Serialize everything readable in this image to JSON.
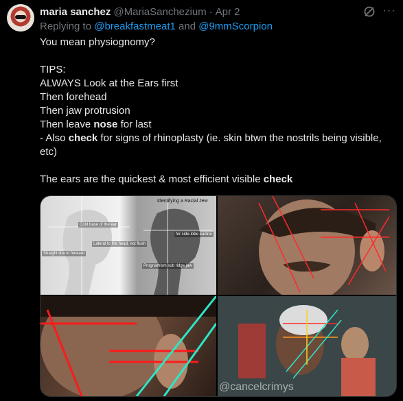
{
  "tweet": {
    "author_name": "maria sanchez",
    "author_handle": "@MariaSanchezium",
    "separator": "·",
    "date": "Apr 2",
    "more_label": "···",
    "reply": {
      "prefix": "Replying to",
      "mention_1": "@breakfastmeat1",
      "conjunction": "and",
      "mention_2": "@9mmScorpion"
    },
    "body": {
      "line_1": "You mean physiognomy?",
      "line_2": "TIPS:",
      "line_3": "ALWAYS Look at the Ears first",
      "line_4": "Then forehead",
      "line_5": "Then jaw protrusion",
      "line_6_pre": "Then leave ",
      "line_6_bold": "nose",
      "line_6_post": " for last",
      "line_7_pre": "- Also ",
      "line_7_bold": "check",
      "line_7_post": " for signs of rhinoplasty (ie. skin btwn the nostrils being visible,",
      "line_8": "etc)",
      "line_9_pre": "The ears are the quickest & most efficient visible ",
      "line_9_bold": "check"
    },
    "media": {
      "panel_1_title": "Identifying a Racial Jew",
      "panel_1_annotations": [
        "Cold base of the ear",
        "Lateral to the head, not flush",
        "for side-lobe earline",
        "Prognathism sub ridge jaw",
        "Straight line to forward"
      ],
      "watermark": "@cancelcrimys"
    }
  }
}
